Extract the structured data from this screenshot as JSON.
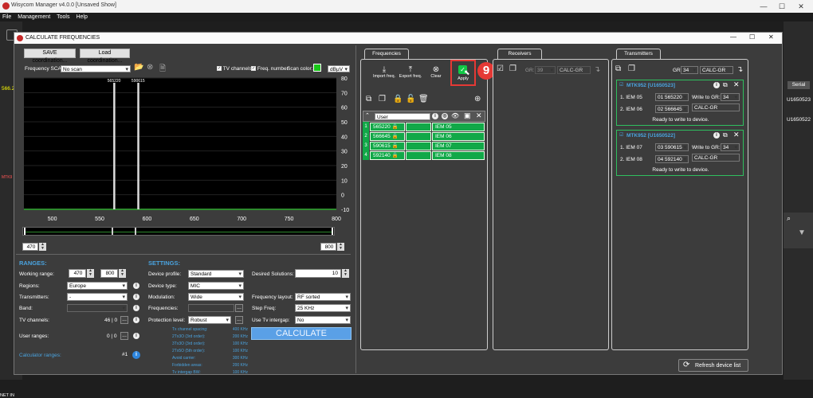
{
  "app": {
    "title": "Wisycom Manager v4.0.0 [Unsaved Show]",
    "minimize": "—",
    "maximize": "☐",
    "close": "✕"
  },
  "menu": [
    "File",
    "Management",
    "Tools",
    "Help"
  ],
  "background": {
    "value1": "566.2",
    "label1": "MTK9",
    "serial_header": "Serial",
    "serial1": "U1650523",
    "serial2": "U1650522",
    "netinfo": "NET IN"
  },
  "dialog": {
    "title": "CALCULATE FREQUENCIES",
    "minimize": "—",
    "maximize": "☐",
    "close": "✕"
  },
  "scan": {
    "save_btn": "SAVE coordination...",
    "load_btn": "Load coordination...",
    "freq_scan_label": "Frequency SCAN:",
    "freq_scan_value": "No scan",
    "tv_channels": "TV channels",
    "freq_number": "Freq. number",
    "scan_color_label": "Scan color:",
    "unit": "dBµV"
  },
  "chart_data": {
    "type": "line",
    "x_ticks": [
      "500",
      "550",
      "600",
      "650",
      "700",
      "750",
      "800"
    ],
    "y_ticks": [
      "80",
      "70",
      "60",
      "50",
      "40",
      "30",
      "20",
      "10",
      "0",
      "-10"
    ],
    "xlim": [
      470,
      800
    ],
    "ylim": [
      -10,
      80
    ],
    "markers": [
      {
        "freq": 565.22,
        "label": "565220"
      },
      {
        "freq": 590.615,
        "label": "590615"
      }
    ],
    "range_min": "470",
    "range_max": "800"
  },
  "ranges": {
    "header": "RANGES:",
    "working_range_label": "Working range:",
    "working_min": "470",
    "working_max": "800",
    "regions_label": "Regions:",
    "regions_value": "Europe",
    "transmitters_label": "Transmitters:",
    "transmitters_value": "-",
    "band_label": "Band:",
    "tv_channels_label": "TV channels:",
    "tv_channels_value": "46 | 0",
    "user_ranges_label": "User ranges:",
    "user_ranges_value": "0 | 0",
    "calculator_ranges_label": "Calculator ranges:",
    "calculator_ranges_value": "#1",
    "more_btn": "..."
  },
  "settings": {
    "header": "SETTINGS:",
    "device_profile_label": "Device profile:",
    "device_profile_value": "Standard",
    "device_type_label": "Device type:",
    "device_type_value": "MIC",
    "modulation_label": "Modulation:",
    "modulation_value": "Wide",
    "frequencies_label": "Frequencies:",
    "protection_label": "Protection level:",
    "protection_value": "Robust",
    "desired_label": "Desired Solutions:",
    "desired_value": "10",
    "freq_layout_label": "Frequency layout:",
    "freq_layout_value": "RF sorted",
    "step_label": "Step Freq:",
    "step_value": "25 KHz",
    "tv_intergap_label": "Use Tv intergap:",
    "tv_intergap_value": "No",
    "calculate_btn": "CALCULATE",
    "spacing": [
      {
        "label": "Tx channel spacing:",
        "value": "400 KHz"
      },
      {
        "label": "2Tx3O (3rd order):",
        "value": "200 KHz"
      },
      {
        "label": "3Tx3O (3rd order):",
        "value": "100 KHz"
      },
      {
        "label": "2Tx5O (5th order):",
        "value": "100 KHz"
      },
      {
        "label": "Avoid carrier:",
        "value": "300 KHz"
      },
      {
        "label": "Forbidden areas:",
        "value": "200 KHz"
      },
      {
        "label": "Tv intergap BW:",
        "value": "100 KHz"
      }
    ]
  },
  "frequencies": {
    "tab": "Frequencies",
    "import": "Import freq.",
    "export": "Export freq.",
    "clear": "Clear",
    "apply": "Apply",
    "step_badge": "9",
    "group_name": "User",
    "rows": [
      {
        "num": "1",
        "freq": "565220",
        "name": "IEM 05"
      },
      {
        "num": "2",
        "freq": "566645",
        "name": "IEM 06"
      },
      {
        "num": "3",
        "freq": "590615",
        "name": "IEM 07"
      },
      {
        "num": "4",
        "freq": "592140",
        "name": "IEM 08"
      }
    ]
  },
  "receivers": {
    "tab": "Receivers",
    "gr_label": "GR:",
    "gr_value": "39",
    "calc_value": "CALC-GR"
  },
  "transmitters": {
    "tab": "Transmitters",
    "gr_label": "GR:",
    "gr_value": "34",
    "calc_value": "CALC-GR",
    "write_label": "Write to GR:",
    "ready": "Ready to write to device.",
    "devices": [
      {
        "name": "MTK952 [U1650523]",
        "ch1": "1. IEM 05",
        "f1": "01 565220",
        "ch2": "2. IEM 06",
        "f2": "02 566645",
        "gr": "34",
        "calc": "CALC-GR"
      },
      {
        "name": "MTK952 [U1650522]",
        "ch1": "1. IEM 07",
        "f1": "03 590615",
        "ch2": "2. IEM 08",
        "f2": "04 592140",
        "gr": "34",
        "calc": "CALC-GR"
      }
    ]
  },
  "refresh_btn": "Refresh device list"
}
